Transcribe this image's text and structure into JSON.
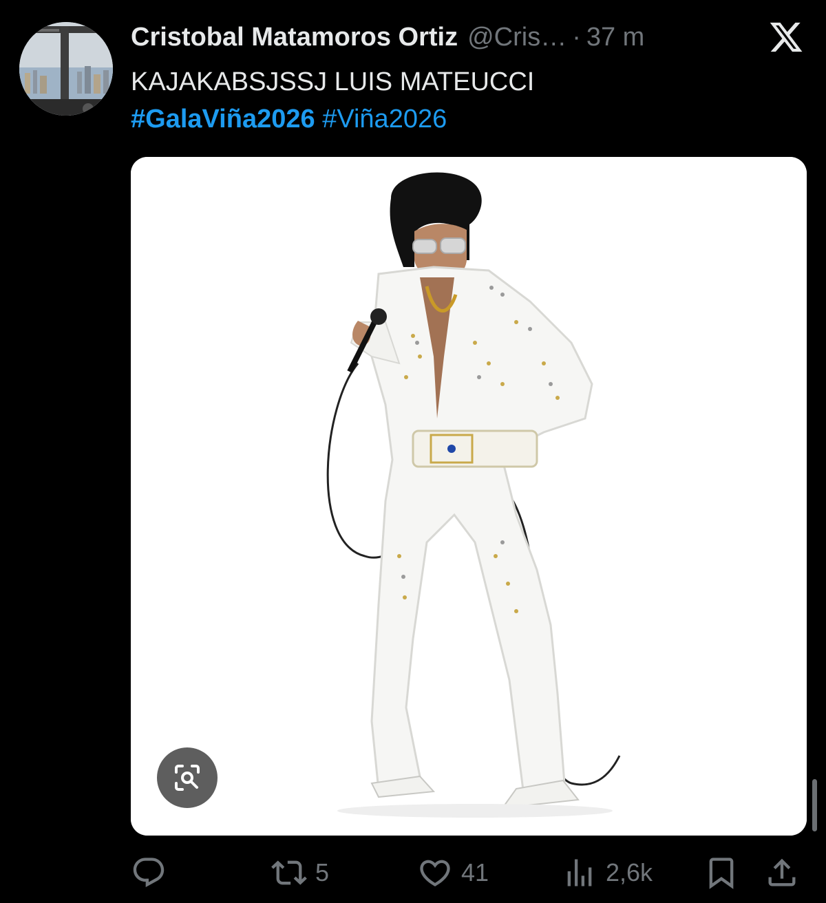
{
  "author": {
    "display_name": "Cristobal Matamoros Ortiz",
    "handle": "@Cris…",
    "separator": "·",
    "time": "37 m"
  },
  "tweet": {
    "text": "KAJAKABSJSSJ LUIS MATEUCCI",
    "hashtags": [
      "#GalaViña2026",
      "#Viña2026"
    ]
  },
  "media": {
    "icon": "lens-search-icon"
  },
  "actions": {
    "reply": {
      "icon": "reply-icon",
      "count": ""
    },
    "retweet": {
      "icon": "retweet-icon",
      "count": "5"
    },
    "like": {
      "icon": "heart-icon",
      "count": "41"
    },
    "views": {
      "icon": "views-icon",
      "count": "2,6k"
    },
    "bookmark": {
      "icon": "bookmark-icon"
    },
    "share": {
      "icon": "share-icon"
    }
  },
  "colors": {
    "background": "#000000",
    "text": "#e7e9ea",
    "secondary": "#71767b",
    "link": "#1d9bf0"
  }
}
